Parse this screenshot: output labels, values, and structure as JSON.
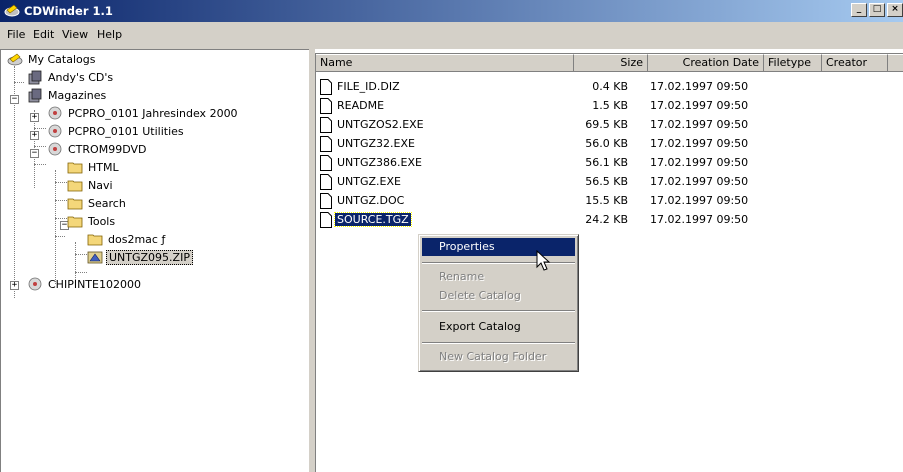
{
  "window": {
    "title": "CDWinder 1.1",
    "minimize": "_",
    "maximize": "□",
    "close": "×"
  },
  "menubar": [
    "File",
    "Edit",
    "View",
    "Help"
  ],
  "tree": {
    "root": "My Catalogs",
    "andys": "Andy's CD's",
    "magazines": "Magazines",
    "pcpro1": "PCPRO_0101 Jahresindex 2000",
    "pcpro2": "PCPRO_0101 Utilities",
    "ctrom": "CTROM99DVD",
    "html": "HTML",
    "navi": "Navi",
    "search": "Search",
    "tools": "Tools",
    "dos2mac": "dos2mac ƒ",
    "untgz": "UNTGZ095.ZIP",
    "chip": "CHIPINTE102000",
    "expand_plus": "+",
    "expand_minus": "−"
  },
  "list": {
    "headers": {
      "name": "Name",
      "size": "Size",
      "date": "Creation Date",
      "type": "Filetype",
      "creator": "Creator"
    },
    "files": [
      {
        "name": "FILE_ID.DIZ",
        "size": "0.4 KB",
        "date": "17.02.1997 09:50"
      },
      {
        "name": "README",
        "size": "1.5 KB",
        "date": "17.02.1997 09:50"
      },
      {
        "name": "UNTGZOS2.EXE",
        "size": "69.5 KB",
        "date": "17.02.1997 09:50"
      },
      {
        "name": "UNTGZ32.EXE",
        "size": "56.0 KB",
        "date": "17.02.1997 09:50"
      },
      {
        "name": "UNTGZ386.EXE",
        "size": "56.1 KB",
        "date": "17.02.1997 09:50"
      },
      {
        "name": "UNTGZ.EXE",
        "size": "56.5 KB",
        "date": "17.02.1997 09:50"
      },
      {
        "name": "UNTGZ.DOC",
        "size": "15.5 KB",
        "date": "17.02.1997 09:50"
      },
      {
        "name": "SOURCE.TGZ",
        "size": "24.2 KB",
        "date": "17.02.1997 09:50"
      }
    ]
  },
  "context_menu": {
    "properties": "Properties",
    "rename": "Rename",
    "delete_catalog": "Delete Catalog",
    "export_catalog": "Export Catalog",
    "new_catalog_folder": "New Catalog Folder"
  },
  "colors": {
    "selection": "#0a246a",
    "face": "#d4d0c8",
    "title_gradient_end": "#a6caf0"
  },
  "icons": [
    "catalogs-icon",
    "cd-stack-icon",
    "cd-disc-icon",
    "folder-icon",
    "zip-archive-icon",
    "file-icon",
    "mouse-pointer-icon"
  ]
}
